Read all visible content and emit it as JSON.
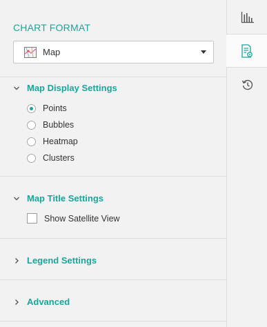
{
  "chart_format": {
    "title": "CHART FORMAT",
    "selected_type": "Map",
    "selected_icon": "map-thumbnail-icon"
  },
  "sections": {
    "map_display": {
      "title": "Map Display Settings",
      "expanded": true,
      "options": [
        {
          "label": "Points",
          "checked": true
        },
        {
          "label": "Bubbles",
          "checked": false
        },
        {
          "label": "Heatmap",
          "checked": false
        },
        {
          "label": "Clusters",
          "checked": false
        }
      ]
    },
    "map_title": {
      "title": "Map Title Settings",
      "expanded": true,
      "checkbox_label": "Show Satellite View",
      "checkbox_checked": false
    },
    "legend": {
      "title": "Legend Settings",
      "expanded": false
    },
    "advanced": {
      "title": "Advanced",
      "expanded": false
    }
  },
  "rail": {
    "items": [
      {
        "name": "chart-bars-icon",
        "active": false
      },
      {
        "name": "format-settings-icon",
        "active": true
      },
      {
        "name": "history-icon",
        "active": false
      }
    ]
  },
  "colors": {
    "accent": "#1aa59a",
    "background": "#f2f2f2",
    "divider": "#dcdcdc"
  }
}
